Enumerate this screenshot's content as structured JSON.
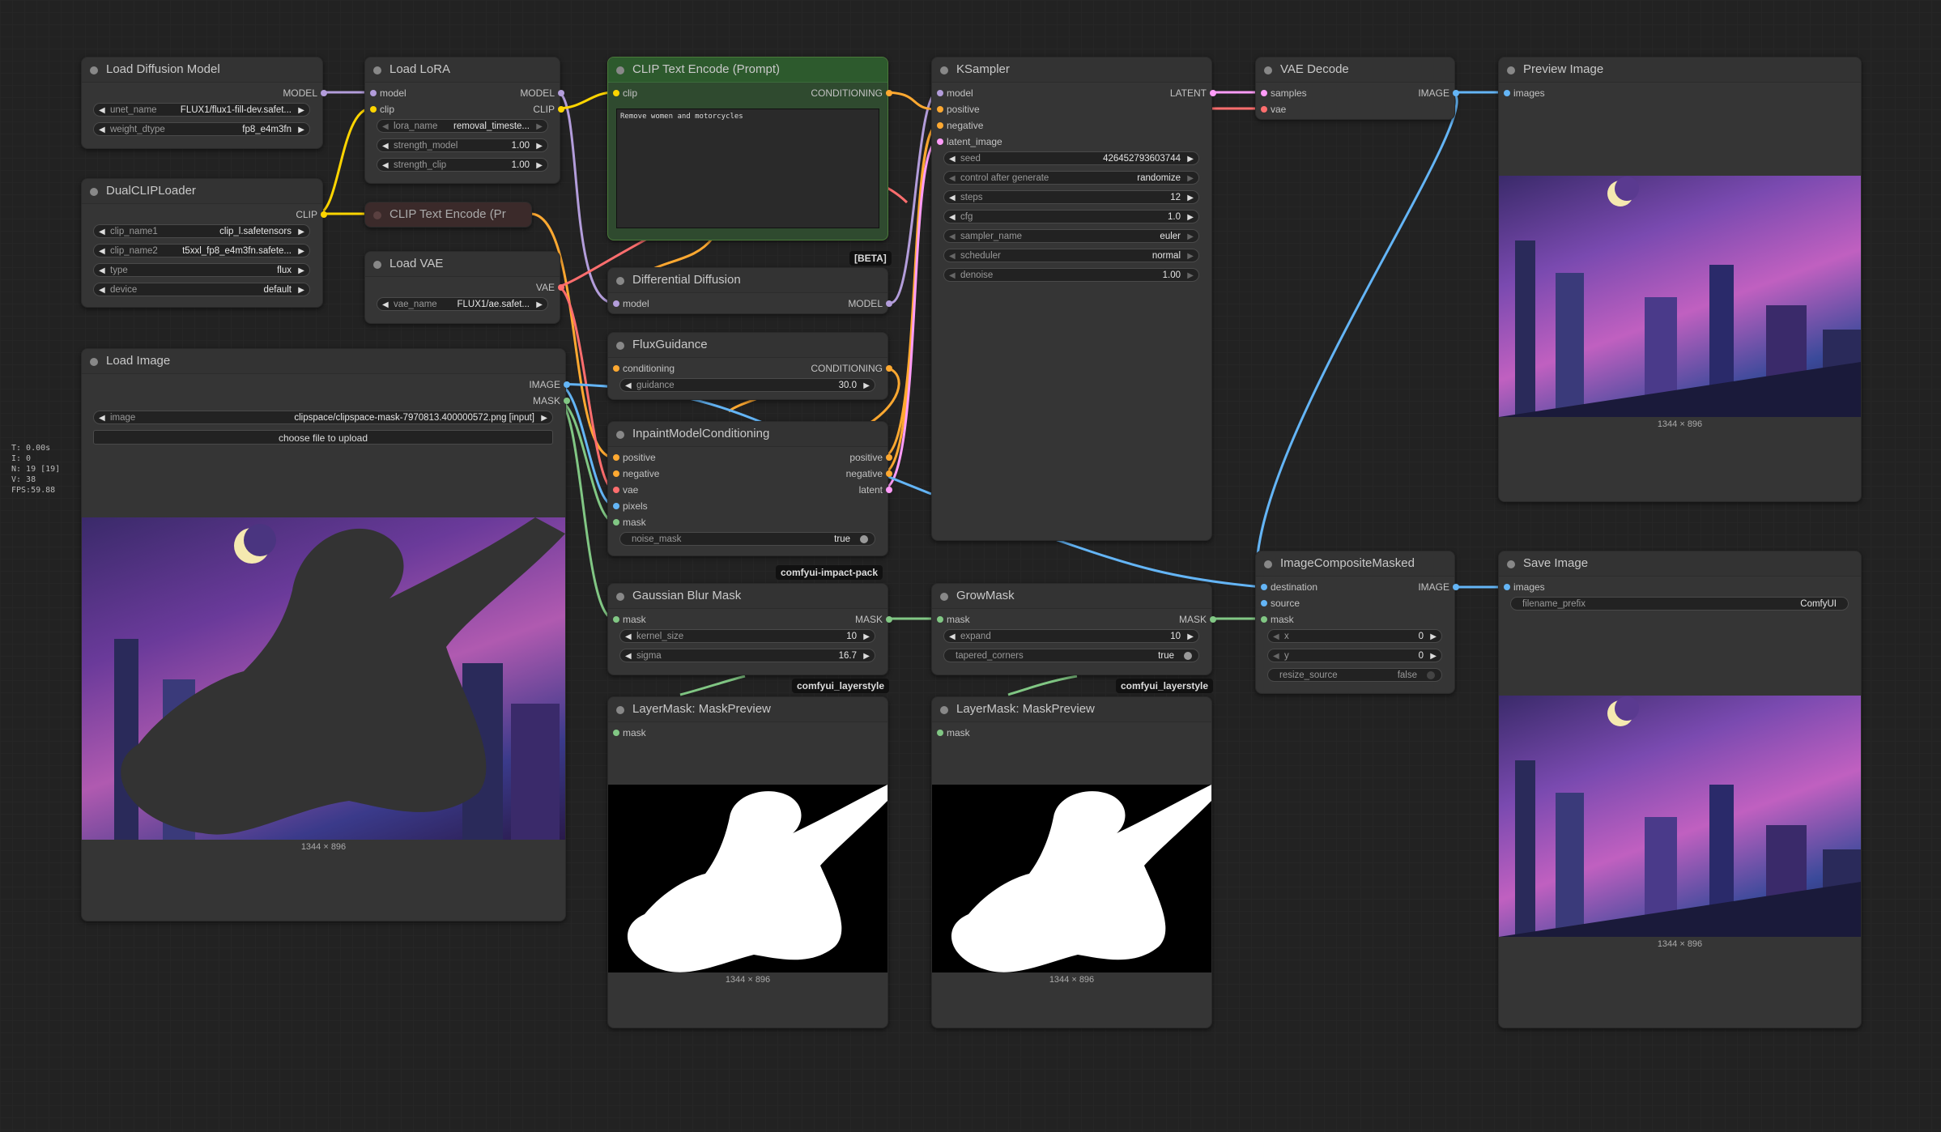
{
  "colors": {
    "model": "#b39ddb",
    "clip": "#ffd500",
    "conditioning": "#ffa931",
    "latent": "#ff9cf9",
    "vae": "#ff6e6e",
    "image": "#64b5f6",
    "mask": "#81c784"
  },
  "stats": [
    "T: 0.00s",
    "I: 0",
    "N: 19 [19]",
    "V: 38",
    "FPS:59.88"
  ],
  "nodes": {
    "load_diffusion": {
      "title": "Load Diffusion Model",
      "out_model": "MODEL",
      "unet_label": "unet_name",
      "unet_value": "FLUX1/flux1-fill-dev.safet...",
      "dtype_label": "weight_dtype",
      "dtype_value": "fp8_e4m3fn"
    },
    "load_lora": {
      "title": "Load LoRA",
      "in_model": "model",
      "in_clip": "clip",
      "out_model": "MODEL",
      "out_clip": "CLIP",
      "lora_label": "lora_name",
      "lora_value": "removal_timeste...",
      "sm_label": "strength_model",
      "sm_value": "1.00",
      "sc_label": "strength_clip",
      "sc_value": "1.00"
    },
    "dual_clip": {
      "title": "DualCLIPLoader",
      "out_clip": "CLIP",
      "c1_label": "clip_name1",
      "c1_value": "clip_l.safetensors",
      "c2_label": "clip_name2",
      "c2_value": "t5xxl_fp8_e4m3fn.safete...",
      "type_label": "type",
      "type_value": "flux",
      "device_label": "device",
      "device_value": "default"
    },
    "clip_encode_small": {
      "title": "CLIP Text Encode (Pr"
    },
    "load_vae": {
      "title": "Load VAE",
      "out_vae": "VAE",
      "vae_label": "vae_name",
      "vae_value": "FLUX1/ae.safet..."
    },
    "load_image": {
      "title": "Load Image",
      "out_image": "IMAGE",
      "out_mask": "MASK",
      "image_label": "image",
      "image_value": "clipspace/clipspace-mask-7970813.400000572.png [input]",
      "upload_label": "choose file to upload",
      "size": "1344 × 896"
    },
    "clip_encode": {
      "title": "CLIP Text Encode (Prompt)",
      "in_clip": "clip",
      "out_cond": "CONDITIONING",
      "text": "Remove women and motorcycles",
      "badge": "[BETA]"
    },
    "diff_diffusion": {
      "title": "Differential Diffusion",
      "in_model": "model",
      "out_model": "MODEL"
    },
    "flux_guidance": {
      "title": "FluxGuidance",
      "in_cond": "conditioning",
      "out_cond": "CONDITIONING",
      "g_label": "guidance",
      "g_value": "30.0"
    },
    "inpaint": {
      "title": "InpaintModelConditioning",
      "in_pos": "positive",
      "in_neg": "negative",
      "in_vae": "vae",
      "in_pixels": "pixels",
      "in_mask": "mask",
      "out_pos": "positive",
      "out_neg": "negative",
      "out_latent": "latent",
      "nm_label": "noise_mask",
      "nm_value": "true",
      "badge": "comfyui-impact-pack"
    },
    "ksampler": {
      "title": "KSampler",
      "in_model": "model",
      "in_pos": "positive",
      "in_neg": "negative",
      "in_latent": "latent_image",
      "out_latent": "LATENT",
      "widgets": [
        {
          "label": "seed",
          "value": "426452793603744"
        },
        {
          "label": "control after generate",
          "value": "randomize"
        },
        {
          "label": "steps",
          "value": "12"
        },
        {
          "label": "cfg",
          "value": "1.0"
        },
        {
          "label": "sampler_name",
          "value": "euler"
        },
        {
          "label": "scheduler",
          "value": "normal"
        },
        {
          "label": "denoise",
          "value": "1.00"
        }
      ]
    },
    "vae_decode": {
      "title": "VAE Decode",
      "in_samples": "samples",
      "in_vae": "vae",
      "out_image": "IMAGE"
    },
    "preview": {
      "title": "Preview Image",
      "in_images": "images",
      "size": "1344 × 896"
    },
    "gblur": {
      "title": "Gaussian Blur Mask",
      "in_mask": "mask",
      "out_mask": "MASK",
      "k_label": "kernel_size",
      "k_value": "10",
      "s_label": "sigma",
      "s_value": "16.7",
      "badge": "comfyui_layerstyle"
    },
    "growmask": {
      "title": "GrowMask",
      "in_mask": "mask",
      "out_mask": "MASK",
      "e_label": "expand",
      "e_value": "10",
      "t_label": "tapered_corners",
      "t_value": "true",
      "badge": "comfyui_layerstyle"
    },
    "composite": {
      "title": "ImageCompositeMasked",
      "in_dest": "destination",
      "in_source": "source",
      "in_mask": "mask",
      "out_image": "IMAGE",
      "x_label": "x",
      "x_value": "0",
      "y_label": "y",
      "y_value": "0",
      "r_label": "resize_source",
      "r_value": "false"
    },
    "save": {
      "title": "Save Image",
      "in_images": "images",
      "fp_label": "filename_prefix",
      "fp_value": "ComfyUI",
      "size": "1344 × 896"
    },
    "maskprev1": {
      "title": "LayerMask: MaskPreview",
      "in_mask": "mask",
      "size": "1344 × 896"
    },
    "maskprev2": {
      "title": "LayerMask: MaskPreview",
      "in_mask": "mask",
      "size": "1344 × 896"
    }
  }
}
